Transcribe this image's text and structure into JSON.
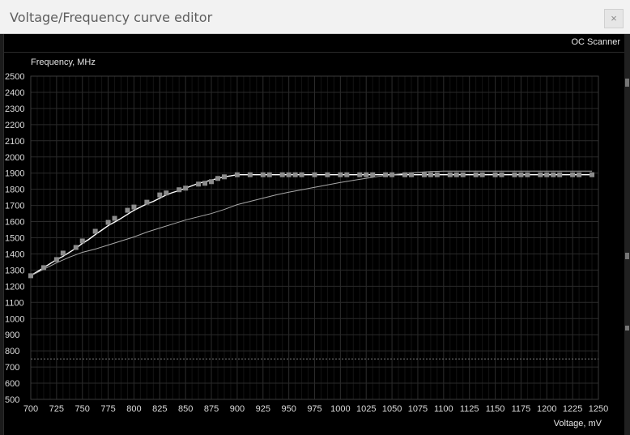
{
  "window": {
    "title": "Voltage/Frequency curve editor",
    "close_label": "×"
  },
  "toolbar": {
    "oc_scanner_label": "OC Scanner"
  },
  "chart_data": {
    "type": "line",
    "ylabel": "Frequency, MHz",
    "xlabel": "Voltage, mV",
    "xlim": [
      700,
      1250
    ],
    "ylim": [
      500,
      2500
    ],
    "x_ticks": [
      700,
      725,
      750,
      775,
      800,
      825,
      850,
      875,
      900,
      925,
      950,
      975,
      1000,
      1025,
      1050,
      1075,
      1100,
      1125,
      1150,
      1175,
      1200,
      1225,
      1250
    ],
    "y_ticks": [
      500,
      600,
      700,
      800,
      900,
      1000,
      1100,
      1200,
      1300,
      1400,
      1500,
      1600,
      1700,
      1800,
      1900,
      2000,
      2100,
      2200,
      2300,
      2400,
      2500
    ],
    "x_minor_step": 6.25,
    "grid": true,
    "reference_line": 750,
    "colors": {
      "curve": "#ffffff",
      "point": "#8c8c8c",
      "secondary": "#a8a8a8",
      "reference": "#777777",
      "grid": "#2a2a2a"
    },
    "series": [
      {
        "kind": "editable",
        "x": [
          700,
          706.25,
          712.5,
          718.75,
          725,
          731.25,
          737.5,
          743.75,
          750,
          756.25,
          762.5,
          768.75,
          775,
          781.25,
          787.5,
          793.75,
          800,
          806.25,
          812.5,
          818.75,
          825,
          831.25,
          837.5,
          843.75,
          850,
          856.25,
          862.5,
          868.75,
          875,
          881.25,
          887.5,
          893.75,
          900,
          906.25,
          912.5,
          918.75,
          925,
          931.25,
          937.5,
          943.75,
          950,
          956.25,
          962.5,
          968.75,
          975,
          981.25,
          987.5,
          993.75,
          1000,
          1006.25,
          1012.5,
          1018.75,
          1025,
          1031.25,
          1037.5,
          1043.75,
          1050,
          1056.25,
          1062.5,
          1068.75,
          1075,
          1081.25,
          1087.5,
          1093.75,
          1100,
          1106.25,
          1112.5,
          1118.75,
          1125,
          1131.25,
          1137.5,
          1143.75,
          1150,
          1156.25,
          1162.5,
          1168.75,
          1175,
          1181.25,
          1187.5,
          1193.75,
          1200,
          1206.25,
          1212.5,
          1218.75,
          1225,
          1231.25,
          1237.5,
          1243.75
        ],
        "y": [
          1265,
          1290,
          1315,
          1340,
          1365,
          1385,
          1410,
          1435,
          1465,
          1490,
          1520,
          1547,
          1575,
          1597,
          1620,
          1645,
          1670,
          1690,
          1710,
          1725,
          1745,
          1765,
          1780,
          1792,
          1807,
          1822,
          1837,
          1847,
          1857,
          1867,
          1877,
          1883,
          1890,
          1890,
          1890,
          1890,
          1890,
          1890,
          1890,
          1890,
          1890,
          1890,
          1890,
          1890,
          1890,
          1890,
          1890,
          1890,
          1890,
          1890,
          1890,
          1890,
          1890,
          1890,
          1890,
          1890,
          1890,
          1890,
          1890,
          1890,
          1890,
          1890,
          1890,
          1890,
          1890,
          1890,
          1890,
          1890,
          1890,
          1890,
          1890,
          1890,
          1890,
          1890,
          1890,
          1890,
          1890,
          1890,
          1890,
          1890,
          1890,
          1890,
          1890,
          1890,
          1890,
          1890,
          1890,
          1890
        ],
        "marker_x": [
          700,
          712.5,
          725,
          731.25,
          743.75,
          750,
          762.5,
          775,
          781.25,
          793.75,
          800,
          812.5,
          825,
          831.25,
          843.75,
          850,
          862.5,
          868.75,
          875,
          881.25,
          887.5,
          900,
          912.5,
          925,
          931.25,
          943.75,
          950,
          956.25,
          962.5,
          975,
          987.5,
          1000,
          1006.25,
          1018.75,
          1025,
          1031.25,
          1043.75,
          1050,
          1062.5,
          1068.75,
          1081.25,
          1087.5,
          1093.75,
          1106.25,
          1112.5,
          1118.75,
          1131.25,
          1137.5,
          1150,
          1156.25,
          1168.75,
          1175,
          1181.25,
          1193.75,
          1200,
          1206.25,
          1212.5,
          1225,
          1231.25,
          1243.75
        ],
        "marker_y": [
          1265,
          1315,
          1365,
          1405,
          1440,
          1480,
          1540,
          1595,
          1620,
          1670,
          1690,
          1720,
          1765,
          1777,
          1797,
          1807,
          1832,
          1837,
          1847,
          1867,
          1877,
          1890,
          1890,
          1890,
          1890,
          1890,
          1890,
          1890,
          1890,
          1890,
          1890,
          1890,
          1890,
          1890,
          1890,
          1890,
          1890,
          1890,
          1890,
          1890,
          1890,
          1890,
          1890,
          1890,
          1890,
          1890,
          1890,
          1890,
          1890,
          1890,
          1890,
          1890,
          1890,
          1890,
          1890,
          1890,
          1890,
          1890,
          1890,
          1890
        ]
      },
      {
        "kind": "default",
        "x": [
          700,
          712.5,
          725,
          737.5,
          750,
          762.5,
          775,
          787.5,
          800,
          812.5,
          825,
          837.5,
          850,
          862.5,
          875,
          887.5,
          900,
          912.5,
          925,
          937.5,
          950,
          962.5,
          975,
          987.5,
          1000,
          1012.5,
          1025,
          1037.5,
          1050,
          1062.5,
          1075,
          1087.5,
          1100,
          1112.5,
          1125,
          1137.5,
          1150,
          1162.5,
          1175,
          1187.5,
          1200,
          1212.5,
          1225,
          1237.5,
          1243.75
        ],
        "y": [
          1265,
          1305,
          1345,
          1380,
          1410,
          1430,
          1455,
          1480,
          1505,
          1535,
          1560,
          1585,
          1610,
          1630,
          1650,
          1675,
          1705,
          1725,
          1745,
          1765,
          1782,
          1797,
          1812,
          1827,
          1842,
          1855,
          1868,
          1880,
          1890,
          1898,
          1905,
          1910,
          1912,
          1912,
          1912,
          1912,
          1912,
          1912,
          1912,
          1912,
          1912,
          1912,
          1912,
          1912,
          1912
        ]
      }
    ]
  }
}
